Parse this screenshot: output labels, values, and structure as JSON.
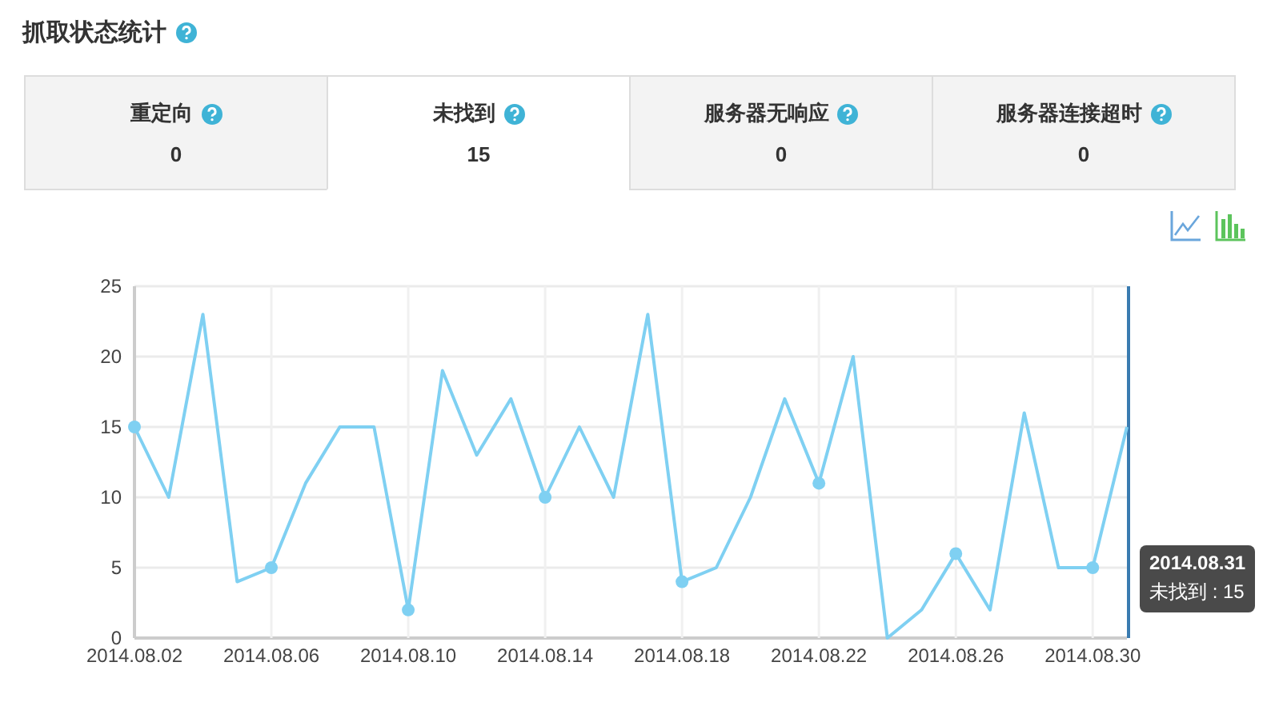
{
  "title": "抓取状态统计",
  "stats": [
    {
      "label": "重定向",
      "value": "0",
      "selected": false
    },
    {
      "label": "未找到",
      "value": "15",
      "selected": true
    },
    {
      "label": "服务器无响应",
      "value": "0",
      "selected": false
    },
    {
      "label": "服务器连接超时",
      "value": "0",
      "selected": false
    }
  ],
  "chart_data": {
    "type": "line",
    "categories": [
      "2014.08.02",
      null,
      null,
      null,
      "2014.08.06",
      null,
      null,
      null,
      "2014.08.10",
      null,
      null,
      null,
      "2014.08.14",
      null,
      null,
      null,
      "2014.08.18",
      null,
      null,
      null,
      "2014.08.22",
      null,
      null,
      null,
      "2014.08.26",
      null,
      null,
      null,
      "2014.08.30",
      null
    ],
    "series": [
      {
        "color": "#7fd0f2",
        "values": [
          15,
          10,
          23,
          4,
          5,
          11,
          15,
          15,
          2,
          19,
          13,
          17,
          10,
          15,
          10,
          23,
          4,
          5,
          10,
          17,
          11,
          20,
          0,
          2,
          6,
          2,
          16,
          5,
          5,
          15
        ]
      }
    ],
    "ylim": [
      0,
      25
    ],
    "yticks": [
      0,
      5,
      10,
      15,
      20,
      25
    ],
    "grid": true
  },
  "tooltip": {
    "title": "2014.08.31",
    "text": "未找到 : 15"
  }
}
